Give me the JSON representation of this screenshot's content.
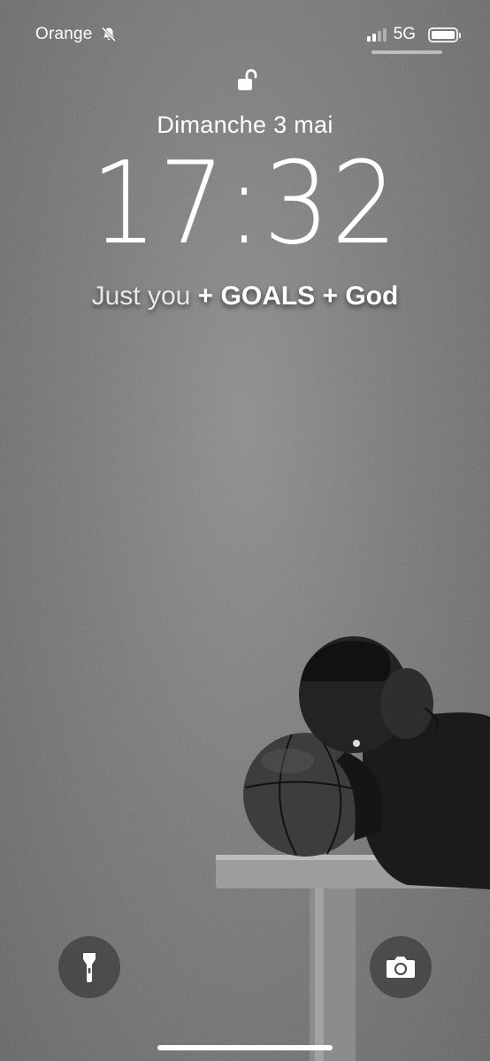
{
  "status_bar": {
    "carrier": "Orange",
    "network": "5G",
    "icons": [
      "bell-slash-icon",
      "signal-icon",
      "battery-icon"
    ],
    "signal_bars_active": 2,
    "signal_bars_total": 4,
    "battery_level": 0.9
  },
  "lock_screen": {
    "lock_icon": "unlocked-padlock-icon",
    "date": "Dimanche 3 mai",
    "time": "17:32",
    "motto": {
      "part1": "Just you",
      "part2": "+ GOALS",
      "part3": "+ God"
    }
  },
  "quick_actions": {
    "flashlight_icon": "flashlight-icon",
    "camera_icon": "camera-icon"
  },
  "colors": {
    "background": "#747474",
    "text": "#ffffff",
    "button_bg": "rgba(40,40,40,0.55)"
  }
}
